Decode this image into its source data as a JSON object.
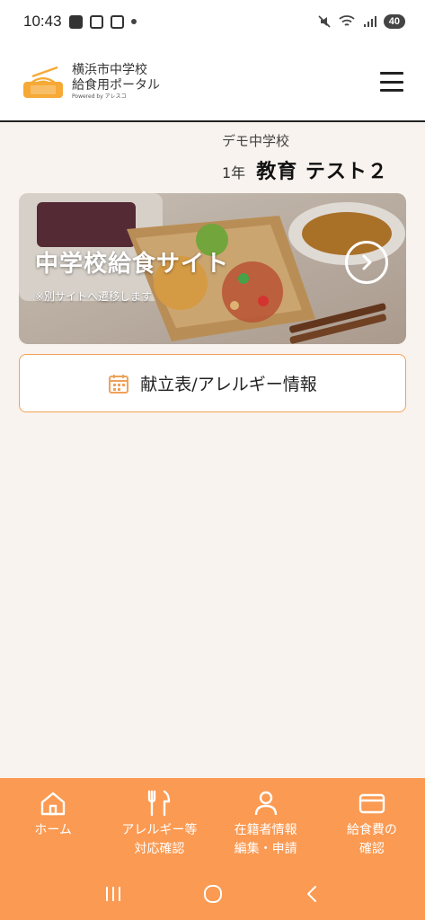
{
  "status_bar": {
    "time": "10:43",
    "battery": "40",
    "icons": [
      "youtube-icon",
      "instagram-icon",
      "gmail-icon",
      "dot-icon",
      "mute-icon",
      "wifi-icon",
      "signal-icon"
    ]
  },
  "header": {
    "logo_line1": "横浜市中学校",
    "logo_line2": "給食用ポータル",
    "powered_by": "Powered by アレスコ",
    "menu_icon": "hamburger-icon"
  },
  "school": {
    "name": "デモ中学校",
    "grade": "1年",
    "student": "教育 テスト２"
  },
  "banner": {
    "title": "中学校給食サイト",
    "note": "※別サイトへ遷移します",
    "arrow_icon": "chevron-right-icon"
  },
  "menu_button": {
    "label": "献立表/アレルギー情報",
    "icon": "calendar-icon"
  },
  "bottom_nav": {
    "items": [
      {
        "label": "ホーム",
        "icon": "home-icon"
      },
      {
        "label": "アレルギー等\n対応確認",
        "icon": "fork-knife-icon"
      },
      {
        "label": "在籍者情報\n編集・申請",
        "icon": "person-icon"
      },
      {
        "label": "給食費の\n確認",
        "icon": "card-icon"
      }
    ]
  },
  "colors": {
    "accent": "#fb9a52",
    "button_border": "#f0a25a",
    "background": "#f8f3ee"
  }
}
